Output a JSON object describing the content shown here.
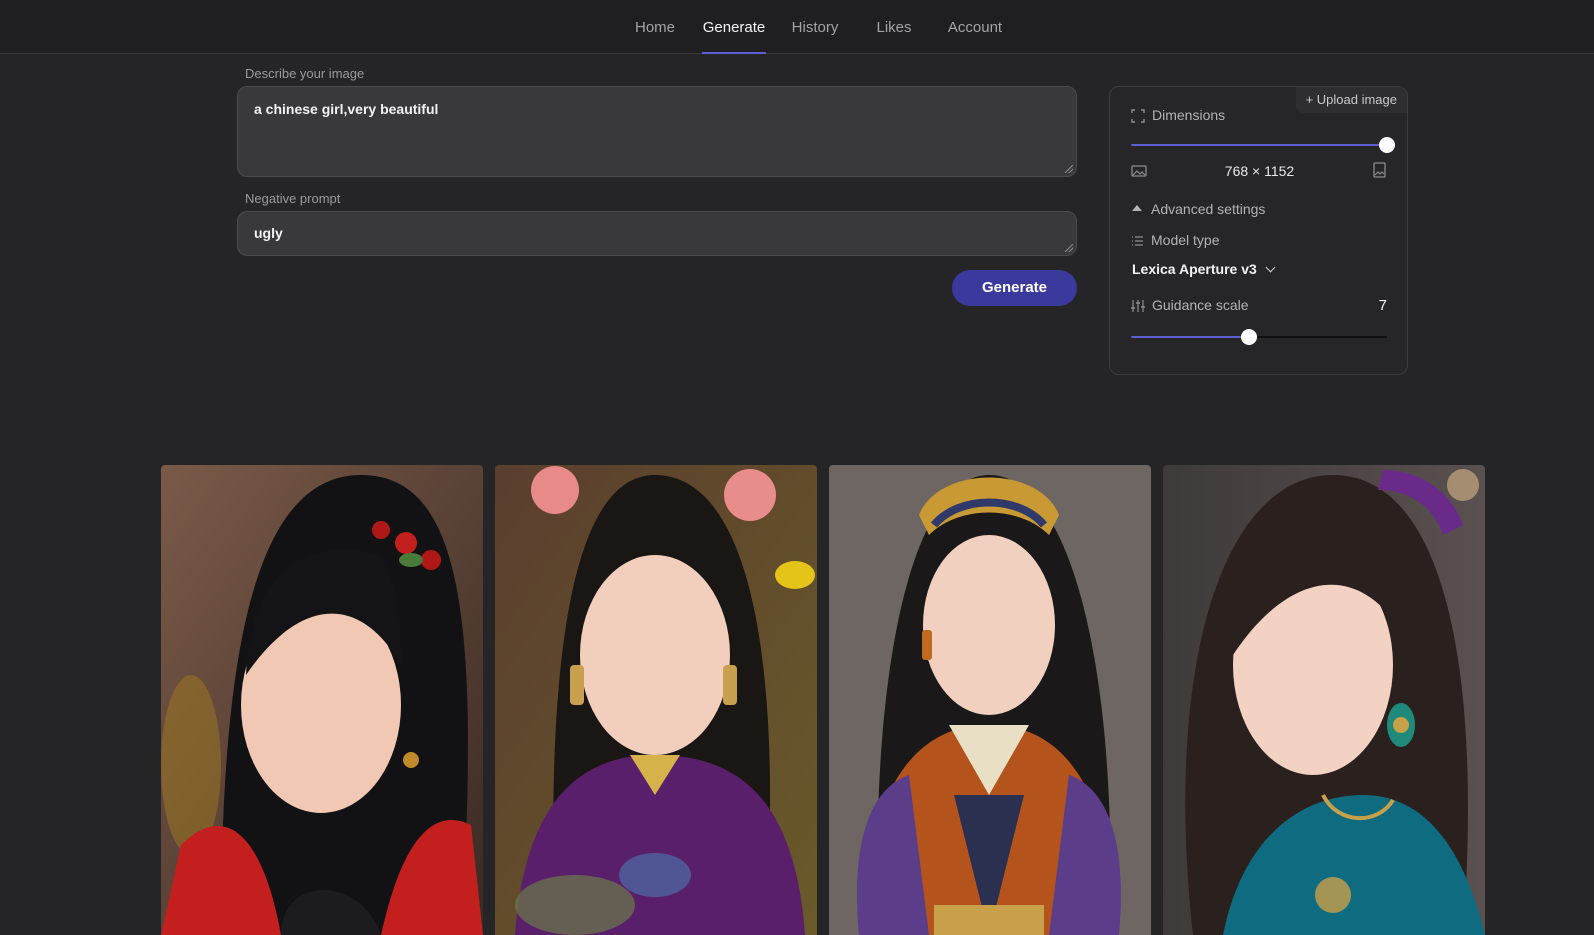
{
  "nav": {
    "items": [
      "Home",
      "Generate",
      "History",
      "Likes",
      "Account"
    ],
    "active": "Generate"
  },
  "prompt": {
    "label": "Describe your image",
    "value": "a chinese girl,very beautiful"
  },
  "negative": {
    "label": "Negative prompt",
    "value": "ugly"
  },
  "generate_button": "Generate",
  "settings": {
    "upload_label": "+ Upload image",
    "dimensions_label": "Dimensions",
    "dimensions_value": "768 × 1152",
    "dimensions_slider_fraction": 1.0,
    "advanced_label": "Advanced settings",
    "model_type_label": "Model type",
    "model_value": "Lexica Aperture v3",
    "guidance_label": "Guidance scale",
    "guidance_value": "7",
    "guidance_slider_fraction": 0.46,
    "accent_color": "#5b5fcf"
  },
  "gallery": [
    {
      "name": "portrait-girl-red-flowers",
      "bg": "#6b4a3a",
      "accent": "#c0282b"
    },
    {
      "name": "portrait-girl-purple-qipao",
      "bg": "#5a4430",
      "accent": "#6a2a7a"
    },
    {
      "name": "portrait-girl-golden-crown",
      "bg": "#6e6460",
      "accent": "#b4541c"
    },
    {
      "name": "portrait-girl-teal-qipao",
      "bg": "#4b4644",
      "accent": "#0f6b80"
    }
  ]
}
